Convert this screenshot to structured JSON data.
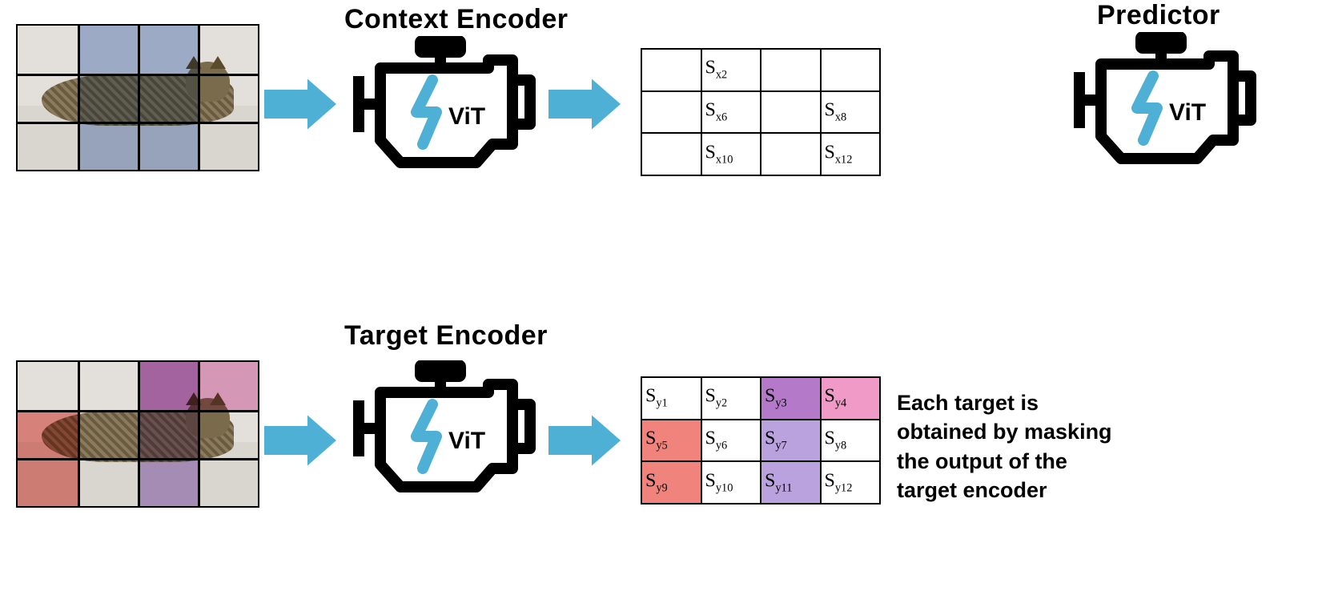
{
  "titles": {
    "context_encoder": "Context Encoder",
    "target_encoder": "Target Encoder",
    "predictor": "Predictor"
  },
  "engines": {
    "context": {
      "label": "ViT"
    },
    "target": {
      "label": "ViT"
    },
    "predictor": {
      "label": "ViT"
    }
  },
  "context_output_grid": {
    "rows": 3,
    "cols": 4,
    "cells": {
      "r0c1": "Sx2",
      "r1c1": "Sx6",
      "r1c3": "Sx8",
      "r2c1": "Sx10",
      "r2c3": "Sx12"
    }
  },
  "target_output_grid": {
    "rows": 3,
    "cols": 4,
    "cells": {
      "r0c0": "Sy1",
      "r0c1": "Sy2",
      "r0c2": "Sy3",
      "r0c3": "Sy4",
      "r1c0": "Sy5",
      "r1c1": "Sy6",
      "r1c2": "Sy7",
      "r1c3": "Sy8",
      "r2c0": "Sy9",
      "r2c1": "Sy10",
      "r2c2": "Sy11",
      "r2c3": "Sy12"
    },
    "highlights": {
      "pink": [
        "r0c2",
        "r0c3"
      ],
      "purple": [
        "r0c2",
        "r1c2",
        "r2c2"
      ],
      "red": [
        "r1c0",
        "r2c0"
      ]
    }
  },
  "context_input_mask": {
    "description": "blue columns 2 and 3 (middle two of four)"
  },
  "target_input_mask": {
    "description": "red column 1 rows 2-3; purple column 3 rows 1-3; pink column 4 row 1"
  },
  "annotation": {
    "line1": "Each target is",
    "line2": "obtained by masking",
    "line3": "the output of the",
    "line4": "target encoder"
  },
  "colors": {
    "arrow": "#4fb0d5",
    "bolt": "#4fb0d5",
    "blue_mask": "rgba(80,120,200,0.45)",
    "red_mask": "rgba(230,60,50,0.55)",
    "purple_mask": "rgba(120,60,180,0.45)",
    "pink_mask": "rgba(220,70,160,0.45)"
  }
}
